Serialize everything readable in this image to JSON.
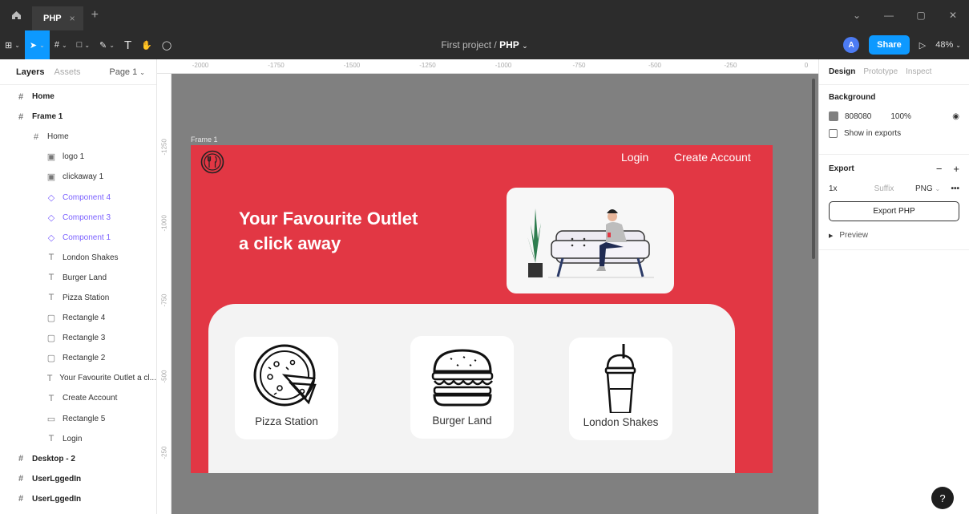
{
  "titlebar": {
    "tab_label": "PHP",
    "close_glyph": "×",
    "new_tab_glyph": "+",
    "win_controls": [
      "⌄",
      "—",
      "▢",
      "✕"
    ]
  },
  "toolbar": {
    "tools": [
      {
        "name": "main-menu",
        "glyph": "⊞"
      },
      {
        "name": "move-tool",
        "glyph": "➤",
        "active": true
      },
      {
        "name": "frame-tool",
        "glyph": "#"
      },
      {
        "name": "shape-tool",
        "glyph": "□"
      },
      {
        "name": "pen-tool",
        "glyph": "✎"
      },
      {
        "name": "text-tool",
        "glyph": "T"
      },
      {
        "name": "hand-tool",
        "glyph": "✋"
      },
      {
        "name": "comment-tool",
        "glyph": "◯"
      }
    ],
    "project": "First project",
    "separator": "/",
    "page": "PHP",
    "avatar_initial": "A",
    "share_label": "Share",
    "play_glyph": "▷",
    "zoom": "48%"
  },
  "left_panel": {
    "tab_layers": "Layers",
    "tab_assets": "Assets",
    "page_selector": "Page 1",
    "layers": [
      {
        "label": "Home",
        "indent": 0,
        "kind": "frame"
      },
      {
        "label": "Frame 1",
        "indent": 0,
        "kind": "frame"
      },
      {
        "label": "Home",
        "indent": 1,
        "kind": "subframe"
      },
      {
        "label": "logo 1",
        "indent": 2,
        "kind": "image"
      },
      {
        "label": "clickaway 1",
        "indent": 2,
        "kind": "image"
      },
      {
        "label": "Component 4",
        "indent": 2,
        "kind": "component"
      },
      {
        "label": "Component 3",
        "indent": 2,
        "kind": "component"
      },
      {
        "label": "Component 1",
        "indent": 2,
        "kind": "component"
      },
      {
        "label": "London Shakes",
        "indent": 2,
        "kind": "text"
      },
      {
        "label": "Burger Land",
        "indent": 2,
        "kind": "text"
      },
      {
        "label": "Pizza Station",
        "indent": 2,
        "kind": "text"
      },
      {
        "label": "Rectangle 4",
        "indent": 2,
        "kind": "rect"
      },
      {
        "label": "Rectangle 3",
        "indent": 2,
        "kind": "rect"
      },
      {
        "label": "Rectangle 2",
        "indent": 2,
        "kind": "rect"
      },
      {
        "label": "Your Favourite Outlet a cl...",
        "indent": 2,
        "kind": "text"
      },
      {
        "label": "Create Account",
        "indent": 2,
        "kind": "text"
      },
      {
        "label": "Rectangle 5",
        "indent": 2,
        "kind": "line"
      },
      {
        "label": "Login",
        "indent": 2,
        "kind": "text"
      },
      {
        "label": "Desktop - 2",
        "indent": 0,
        "kind": "frame"
      },
      {
        "label": "UserLggedIn",
        "indent": 0,
        "kind": "frame"
      },
      {
        "label": "UserLggedIn",
        "indent": 0,
        "kind": "frame"
      }
    ]
  },
  "rulers": {
    "top": [
      "-2000",
      "-1750",
      "-1500",
      "-1250",
      "-1000",
      "-750",
      "-500",
      "-250",
      "0"
    ],
    "left": [
      "-1250",
      "-1000",
      "-750",
      "-500",
      "-250"
    ]
  },
  "canvas": {
    "background": "#808080",
    "frame_label": "Frame 1",
    "frame_color": "#e23744",
    "nav_login": "Login",
    "nav_create_account": "Create Account",
    "hero_line1": "Your Favourite Outlet",
    "hero_line2": "a click away",
    "cards": [
      {
        "label": "Pizza Station",
        "icon": "pizza-icon"
      },
      {
        "label": "Burger Land",
        "icon": "burger-icon"
      },
      {
        "label": "London Shakes",
        "icon": "shake-icon"
      }
    ]
  },
  "right_panel": {
    "tab_design": "Design",
    "tab_prototype": "Prototype",
    "tab_inspect": "Inspect",
    "background_title": "Background",
    "bg_hex": "808080",
    "bg_opacity": "100%",
    "show_in_exports": "Show in exports",
    "export_title": "Export",
    "export_scale": "1x",
    "suffix_placeholder": "Suffix",
    "format": "PNG",
    "more": "•••",
    "export_button": "Export PHP",
    "preview": "Preview"
  },
  "help_glyph": "?"
}
